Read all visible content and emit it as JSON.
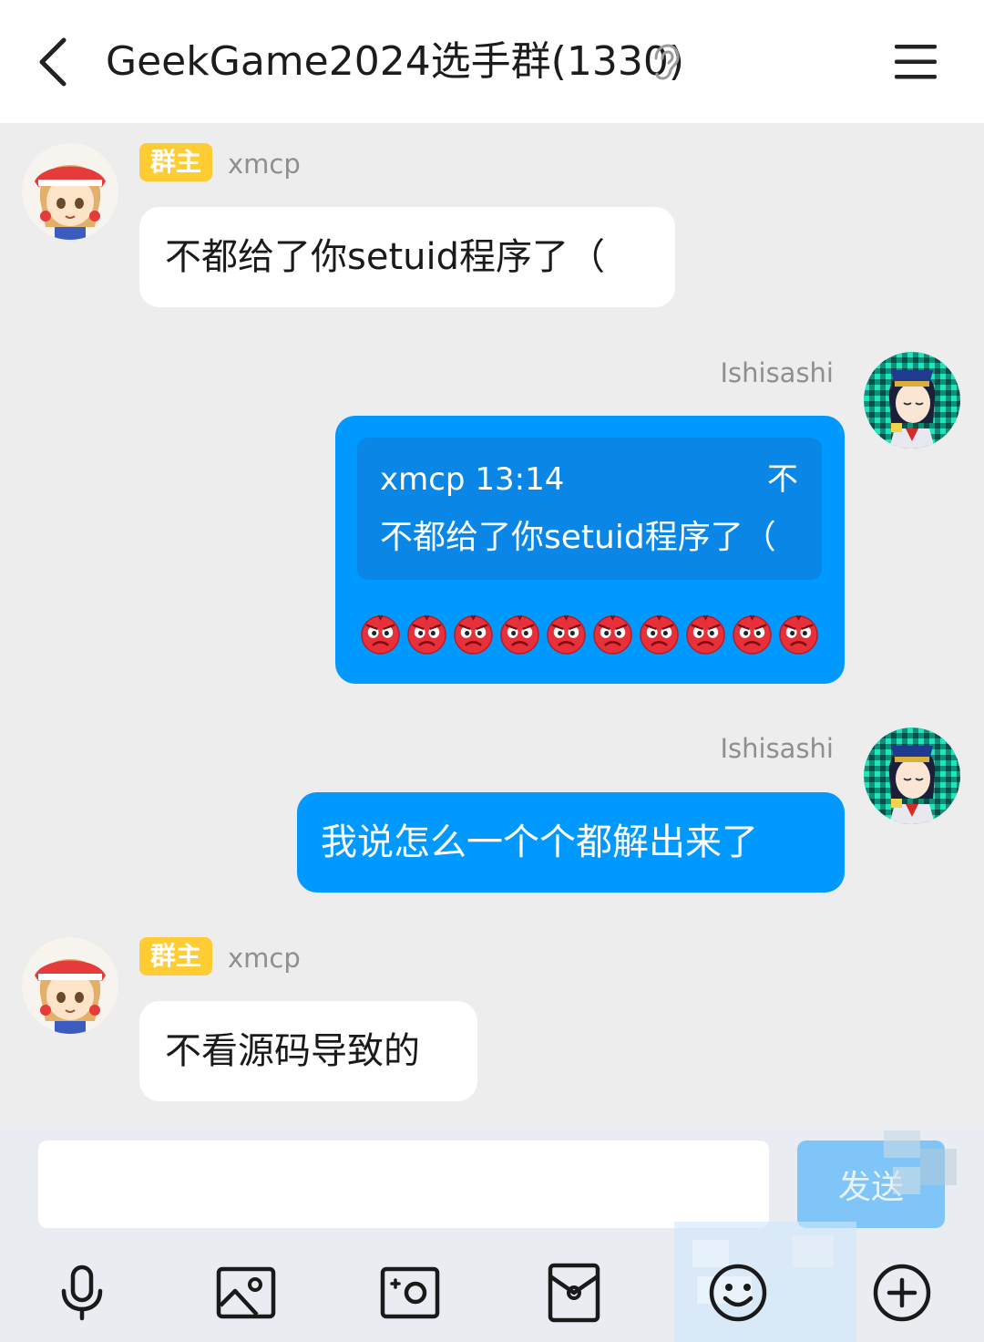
{
  "header": {
    "title": "GeekGame2024选手群(1330)",
    "back_icon": "chevron-left-icon",
    "ear_icon": "ear-icon",
    "menu_icon": "hamburger-menu-icon"
  },
  "messages": [
    {
      "direction": "incoming",
      "badge": "群主",
      "sender": "xmcp",
      "text": "不都给了你setuid程序了（"
    },
    {
      "direction": "outgoing",
      "sender": "Ishisashi",
      "quote": {
        "sender": "xmcp",
        "time": "13:14",
        "text": "不都给了你setuid程序了（"
      },
      "emoji": "angry-face-icon",
      "emoji_count": 10
    },
    {
      "direction": "outgoing",
      "sender": "Ishisashi",
      "text": "我说怎么一个个都解出来了"
    },
    {
      "direction": "incoming",
      "badge": "群主",
      "sender": "xmcp",
      "text": "不看源码导致的"
    }
  ],
  "quote_arrow": "不",
  "input": {
    "placeholder": "",
    "value": "",
    "send_label": "发送"
  },
  "toolbar": [
    "microphone-icon",
    "image-icon",
    "camera-icon",
    "red-packet-icon",
    "emoji-icon",
    "plus-circle-icon"
  ],
  "colors": {
    "accent": "#0099ff",
    "badge": "#ffcc33",
    "background": "#ededed",
    "sent_bubble": "#0099ff",
    "received_bubble": "#ffffff",
    "send_button": "#80c5f7"
  }
}
